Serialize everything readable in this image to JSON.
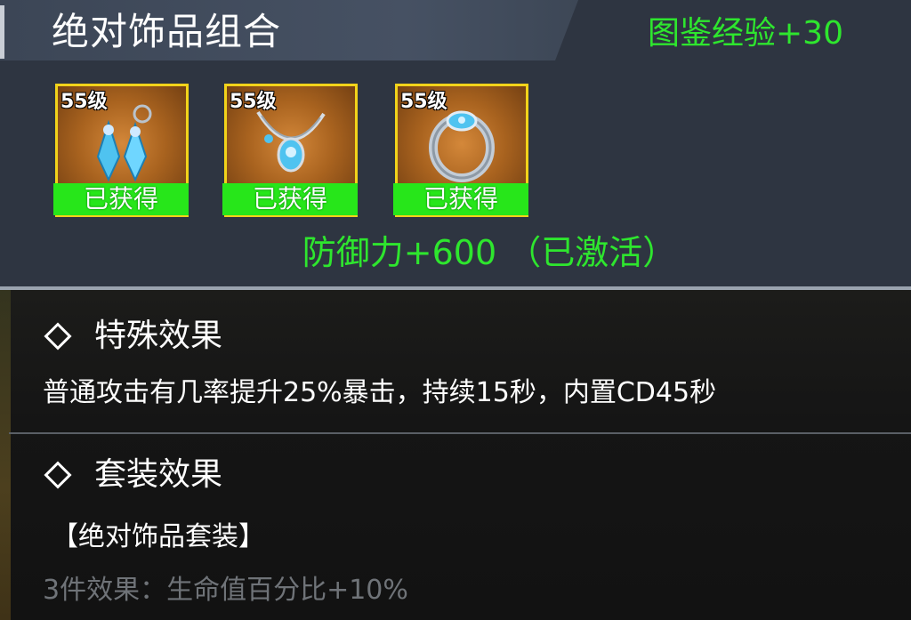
{
  "header": {
    "title": "绝对饰品组合",
    "exp_bonus": "图鉴经验+30"
  },
  "items": [
    {
      "level": "55级",
      "status": "已获得",
      "icon": "earrings-icon"
    },
    {
      "level": "55级",
      "status": "已获得",
      "icon": "necklace-icon"
    },
    {
      "level": "55级",
      "status": "已获得",
      "icon": "ring-icon"
    }
  ],
  "combo_bonus": "防御力+600 （已激活）",
  "special_effect": {
    "title": "特殊效果",
    "description": "普通攻击有几率提升25%暴击，持续15秒，内置CD45秒"
  },
  "set_effect": {
    "title": "套装效果",
    "set_name": "【绝对饰品套装】",
    "tier_3": "3件效果：生命值百分比+10%"
  },
  "colors": {
    "accent_green": "#2ee62e",
    "status_green": "#27e61a",
    "frame_gold": "#f2d31a",
    "inactive_text": "#6f7378"
  }
}
